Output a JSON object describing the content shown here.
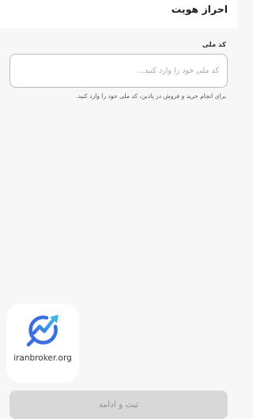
{
  "header": {
    "title": "احراز هویت"
  },
  "national_id": {
    "label": "کد ملی",
    "value": "",
    "placeholder": "کد ملی خود را وارد کنید...",
    "helper": "برای انجام خرید و فروش در پادبن، کد ملی خود را وارد کنید."
  },
  "watermark": {
    "text": "iranbroker.org",
    "icon": "chart-trend-arrow-icon"
  },
  "footer": {
    "submit_label": "ثبت و ادامه"
  },
  "colors": {
    "background": "#f7f7f7",
    "input_border": "#bdbdbd",
    "button_disabled": "#d8d8d8",
    "button_text": "#8e8e8e",
    "logo_blue": "#3b6fe0",
    "logo_cyan": "#3fb5e8"
  }
}
